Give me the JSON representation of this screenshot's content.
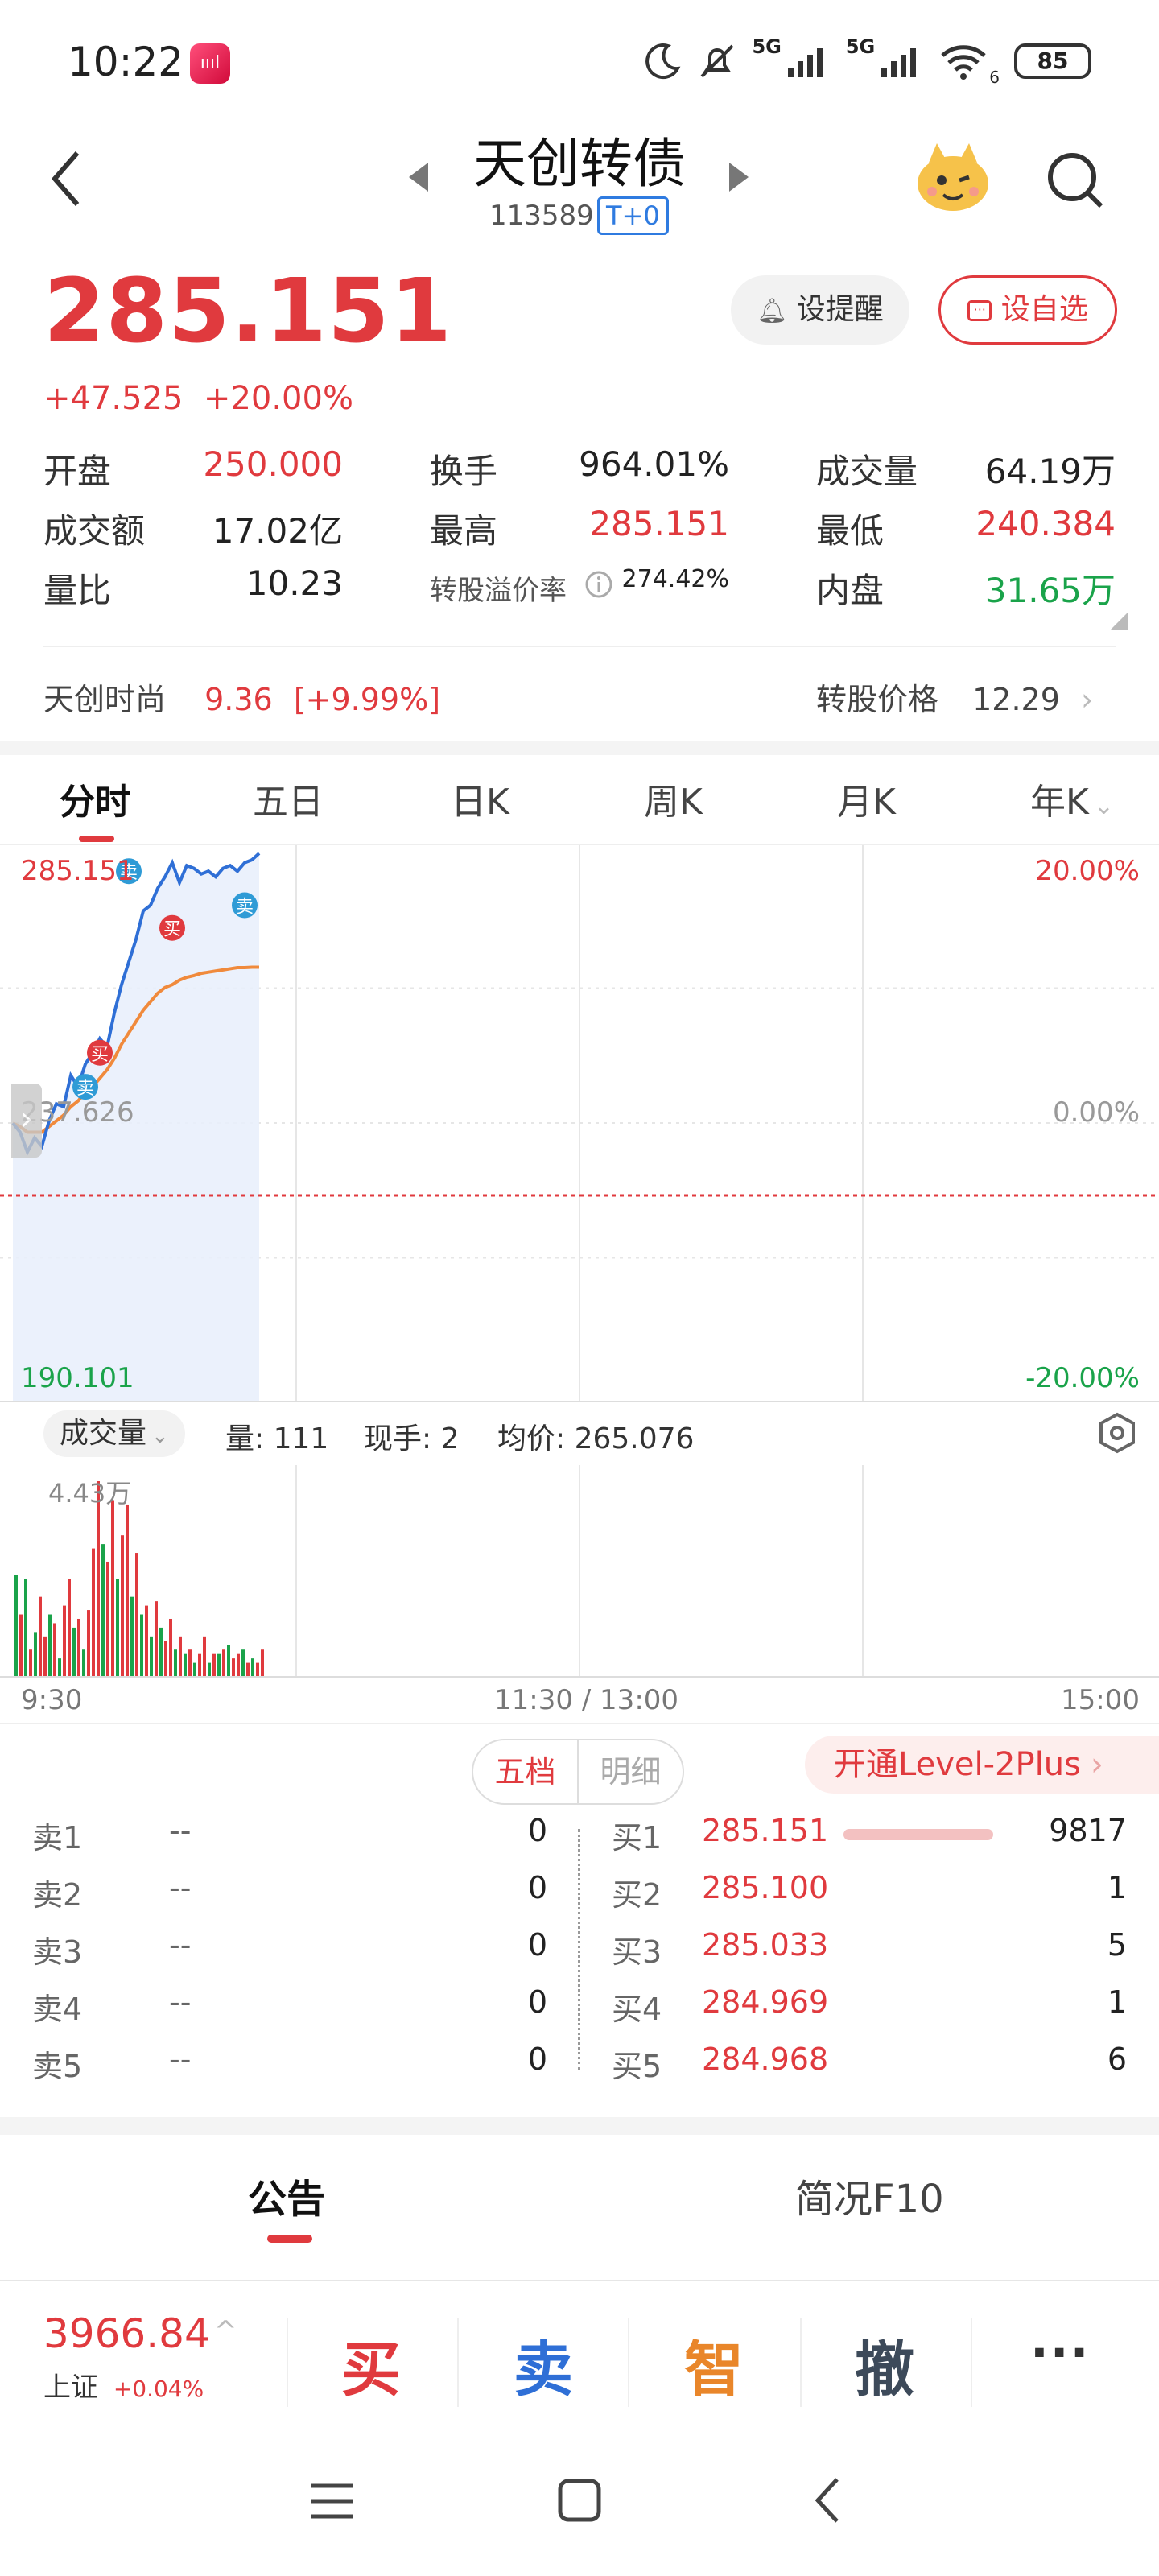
{
  "status_bar": {
    "time": "10:22",
    "app_badge": "ıııl",
    "network": "5G",
    "network2": "5G",
    "wifi_level": "6",
    "battery": "85"
  },
  "header": {
    "title": "天创转债",
    "code": "113589",
    "tag": "T+0",
    "remind_label": "设提醒",
    "watch_label": "设自选"
  },
  "quote": {
    "price": "285.151",
    "change": "+47.525",
    "change_pct": "+20.00%",
    "stats": [
      {
        "label": "开盘",
        "value": "250.000",
        "color": "red"
      },
      {
        "label": "换手",
        "value": "964.01%",
        "color": "dark"
      },
      {
        "label": "成交量",
        "value": "64.19万",
        "color": "dark"
      },
      {
        "label": "成交额",
        "value": "17.02亿",
        "color": "dark"
      },
      {
        "label": "最高",
        "value": "285.151",
        "color": "red"
      },
      {
        "label": "最低",
        "value": "240.384",
        "color": "red"
      },
      {
        "label": "量比",
        "value": "10.23",
        "color": "dark"
      },
      {
        "label": "转股溢价率",
        "value": "274.42%",
        "color": "dark"
      },
      {
        "label": "内盘",
        "value": "31.65万",
        "color": "green"
      }
    ],
    "stock_name": "天创时尚",
    "stock_price": "9.36",
    "stock_change": "[+9.99%]",
    "conv_price_label": "转股价格",
    "conv_price": "12.29"
  },
  "tabs": [
    "分时",
    "五日",
    "日K",
    "周K",
    "月K",
    "年K"
  ],
  "intraday": {
    "high_label": "285.151",
    "mid_label": "237.626",
    "low_label": "190.101",
    "pct_high": "20.00%",
    "pct_mid": "0.00%",
    "pct_low": "-20.00%",
    "buy_marker": "买",
    "sell_marker": "卖",
    "chart_data": {
      "type": "line",
      "ylim": [
        190.101,
        285.151
      ],
      "prev_close": 237.626,
      "series": [
        {
          "role": "price",
          "values": [
            237.6,
            236.0,
            232.5,
            235.0,
            233.5,
            238.0,
            241.0,
            240.5,
            246.0,
            244.0,
            248.0,
            250.0,
            252.5,
            251.0,
            257.0,
            262.0,
            266.0,
            270.0,
            275.0,
            276.0,
            279.0,
            281.0,
            283.5,
            280.0,
            283.0,
            282.5,
            281.5,
            282.0,
            281.0,
            282.5,
            283.0,
            282.0,
            283.5,
            284.0,
            285.151
          ]
        },
        {
          "role": "average",
          "values": [
            237.6,
            237.0,
            236.0,
            236.0,
            236.0,
            237.0,
            238.0,
            239.0,
            240.5,
            241.5,
            243.0,
            244.0,
            245.5,
            247.0,
            249.0,
            251.5,
            253.5,
            255.5,
            257.5,
            259.0,
            260.5,
            261.5,
            262.0,
            262.8,
            263.3,
            263.6,
            264.0,
            264.2,
            264.4,
            264.6,
            264.8,
            265.0,
            265.0,
            265.076,
            265.076
          ]
        }
      ]
    }
  },
  "volume": {
    "selector": "成交量",
    "qty": "量: 111",
    "hand": "现手: 2",
    "avg": "均价: 265.076",
    "max_label": "4.43万",
    "time_start": "9:30",
    "time_mid": "11:30 / 13:00",
    "time_end": "15:00",
    "chart_data": {
      "type": "bar",
      "ylim": [
        0,
        4.43
      ],
      "values": [
        2.3,
        1.4,
        2.2,
        0.6,
        1.0,
        1.8,
        0.9,
        1.4,
        1.2,
        0.4,
        1.6,
        2.2,
        1.1,
        1.3,
        0.6,
        1.5,
        2.9,
        4.43,
        3.0,
        2.6,
        4.0,
        2.2,
        3.2,
        3.9,
        1.8,
        2.8,
        1.4,
        1.6,
        0.9,
        1.7,
        1.1,
        0.8,
        1.3,
        0.6,
        0.9,
        0.5,
        0.6,
        0.3,
        0.5,
        0.9,
        0.3,
        0.5,
        0.5,
        0.6,
        0.7,
        0.4,
        0.5,
        0.6,
        0.3,
        0.4,
        0.3,
        0.6
      ],
      "colors": [
        "g",
        "r",
        "g",
        "r",
        "g",
        "r",
        "r",
        "g",
        "r",
        "g",
        "r",
        "r",
        "g",
        "r",
        "g",
        "r",
        "r",
        "r",
        "g",
        "r",
        "r",
        "g",
        "r",
        "r",
        "g",
        "r",
        "g",
        "r",
        "g",
        "r",
        "g",
        "r",
        "r",
        "g",
        "r",
        "g",
        "r",
        "g",
        "r",
        "r",
        "g",
        "r",
        "g",
        "r",
        "g",
        "r",
        "r",
        "g",
        "r",
        "g",
        "r",
        "r"
      ]
    }
  },
  "order_book": {
    "tab_active": "五档",
    "tab_inactive": "明细",
    "level2": "开通Level-2Plus",
    "asks": [
      {
        "label": "卖1",
        "price": "--",
        "qty": "0"
      },
      {
        "label": "卖2",
        "price": "--",
        "qty": "0"
      },
      {
        "label": "卖3",
        "price": "--",
        "qty": "0"
      },
      {
        "label": "卖4",
        "price": "--",
        "qty": "0"
      },
      {
        "label": "卖5",
        "price": "--",
        "qty": "0"
      }
    ],
    "bids": [
      {
        "label": "买1",
        "price": "285.151",
        "qty": "9817"
      },
      {
        "label": "买2",
        "price": "285.100",
        "qty": "1"
      },
      {
        "label": "买3",
        "price": "285.033",
        "qty": "5"
      },
      {
        "label": "买4",
        "price": "284.969",
        "qty": "1"
      },
      {
        "label": "买5",
        "price": "284.968",
        "qty": "6"
      }
    ]
  },
  "info_tabs": {
    "left": "公告",
    "right": "简况F10"
  },
  "bottom": {
    "index_value": "3966.84",
    "index_name": "上证",
    "index_change": "+0.04%",
    "buy": "买",
    "sell": "卖",
    "smart": "智",
    "cancel": "撤",
    "more": "···"
  }
}
